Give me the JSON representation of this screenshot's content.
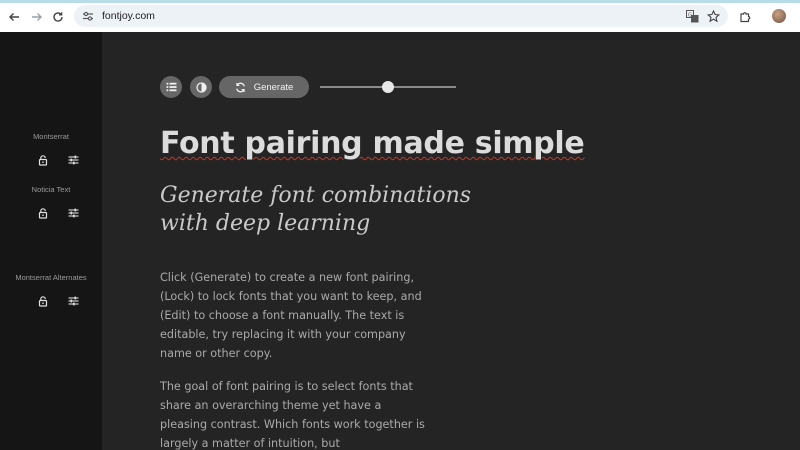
{
  "browser": {
    "url": "fontjoy.com",
    "icons": [
      "back-arrow-icon",
      "forward-arrow-icon",
      "reload-icon",
      "site-settings-icon",
      "translate-icon",
      "bookmark-star-icon",
      "extensions-icon",
      "profile-avatar"
    ]
  },
  "sidebar": {
    "fonts": [
      {
        "name": "Montserrat"
      },
      {
        "name": "Noticia Text"
      },
      {
        "name": "Montserrat Alternates"
      }
    ]
  },
  "toolbar": {
    "generate_label": "Generate",
    "slider_value": 0.5,
    "icons": [
      "list-icon",
      "contrast-icon",
      "refresh-icon"
    ]
  },
  "content": {
    "headline": "Font pairing made simple",
    "subheading": "Generate font combinations with deep learning",
    "paragraph1": "Click (Generate) to create a new font pairing, (Lock) to lock fonts that you want to keep, and (Edit) to choose a font manually. The text is editable, try replacing it with your company name or other copy.",
    "paragraph2": "The goal of font pairing is to select fonts that share an overarching theme yet have a pleasing contrast. Which fonts work together is largely a matter of intuition, but"
  },
  "colors": {
    "main_bg": "#242424",
    "sidebar_bg": "#151515",
    "button_bg": "#666666",
    "headline": "#dcdcdc"
  }
}
